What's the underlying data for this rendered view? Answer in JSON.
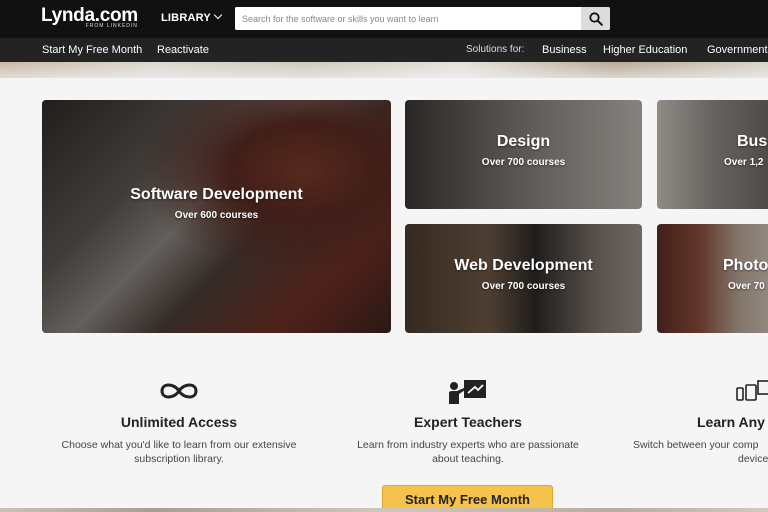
{
  "header": {
    "logo_main": "Lynda.com",
    "logo_sub": "FROM LINKEDIN",
    "library_label": "LIBRARY",
    "search_placeholder": "Search for the software or skills you want to learn"
  },
  "navbar": {
    "free_month": "Start My Free Month",
    "reactivate": "Reactivate",
    "solutions_for": "Solutions for:",
    "business": "Business",
    "higher_education": "Higher Education",
    "government": "Government"
  },
  "tiles": [
    {
      "title": "Software Development",
      "count": "Over 600 courses"
    },
    {
      "title": "Design",
      "count": "Over 700 courses"
    },
    {
      "title": "Bus",
      "count": "Over 1,2"
    },
    {
      "title": "Web Development",
      "count": "Over 700 courses"
    },
    {
      "title": "Photo",
      "count": "Over 70"
    }
  ],
  "features": [
    {
      "title": "Unlimited Access",
      "desc_line1": "Choose what you'd like to learn from our extensive",
      "desc_line2": "subscription library.",
      "icon": "infinity-icon"
    },
    {
      "title": "Expert Teachers",
      "desc_line1": "Learn from industry experts who are passionate",
      "desc_line2": "about teaching.",
      "icon": "teacher-board-icon"
    },
    {
      "title": "Learn Any",
      "desc_line1": "Switch between your comp",
      "desc_line2": "device",
      "icon": "devices-icon"
    }
  ],
  "cta": {
    "label": "Start My Free Month"
  },
  "colors": {
    "topbar": "#111111",
    "navbar": "#232323",
    "cta": "#f5c34b"
  }
}
